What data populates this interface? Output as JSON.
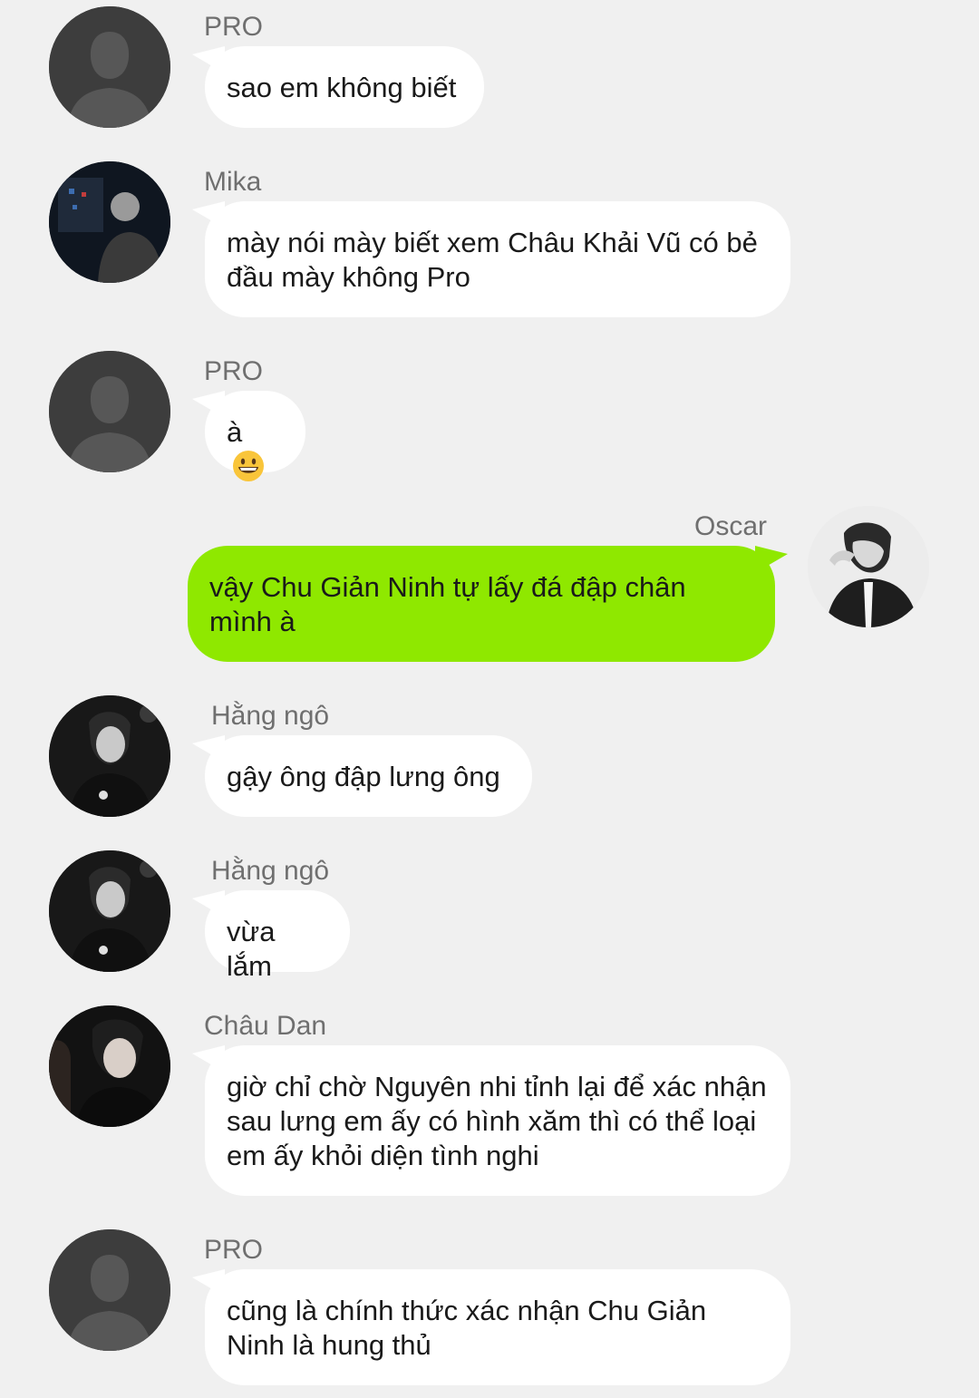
{
  "messages": [
    {
      "sender": "PRO",
      "text": "sao em không biết",
      "avatar": "default-avatar"
    },
    {
      "sender": "Mika",
      "text": "mày nói mày biết xem Châu Khải Vũ có bẻ đầu mày không Pro",
      "avatar": "photo-avatar"
    },
    {
      "sender": "PRO",
      "text": "à",
      "avatar": "default-avatar",
      "emoji": "grinning-face-emoji"
    },
    {
      "sender": "Oscar",
      "text": "vậy Chu Giản Ninh tự lấy đá đập chân mình à",
      "avatar": "photo-avatar",
      "own": true
    },
    {
      "sender": "Hằng ngô",
      "text": "gậy ông đập lưng ông",
      "avatar": "photo-avatar"
    },
    {
      "sender": "Hằng ngô",
      "text": "vừa lắm",
      "avatar": "photo-avatar"
    },
    {
      "sender": "Châu Dan",
      "text": "giờ chỉ chờ Nguyên nhi tỉnh lại để xác nhận sau lưng em ấy có hình xăm thì có thể loại em ấy khỏi diện tình nghi",
      "avatar": "photo-avatar"
    },
    {
      "sender": "PRO",
      "text": "cũng là chính thức xác nhận Chu Giản Ninh là hung thủ",
      "avatar": "default-avatar"
    }
  ],
  "colors": {
    "background": "#f0f0f0",
    "incoming_bubble": "#ffffff",
    "outgoing_bubble": "#8fe800",
    "sender_name": "#6f6f6f"
  }
}
